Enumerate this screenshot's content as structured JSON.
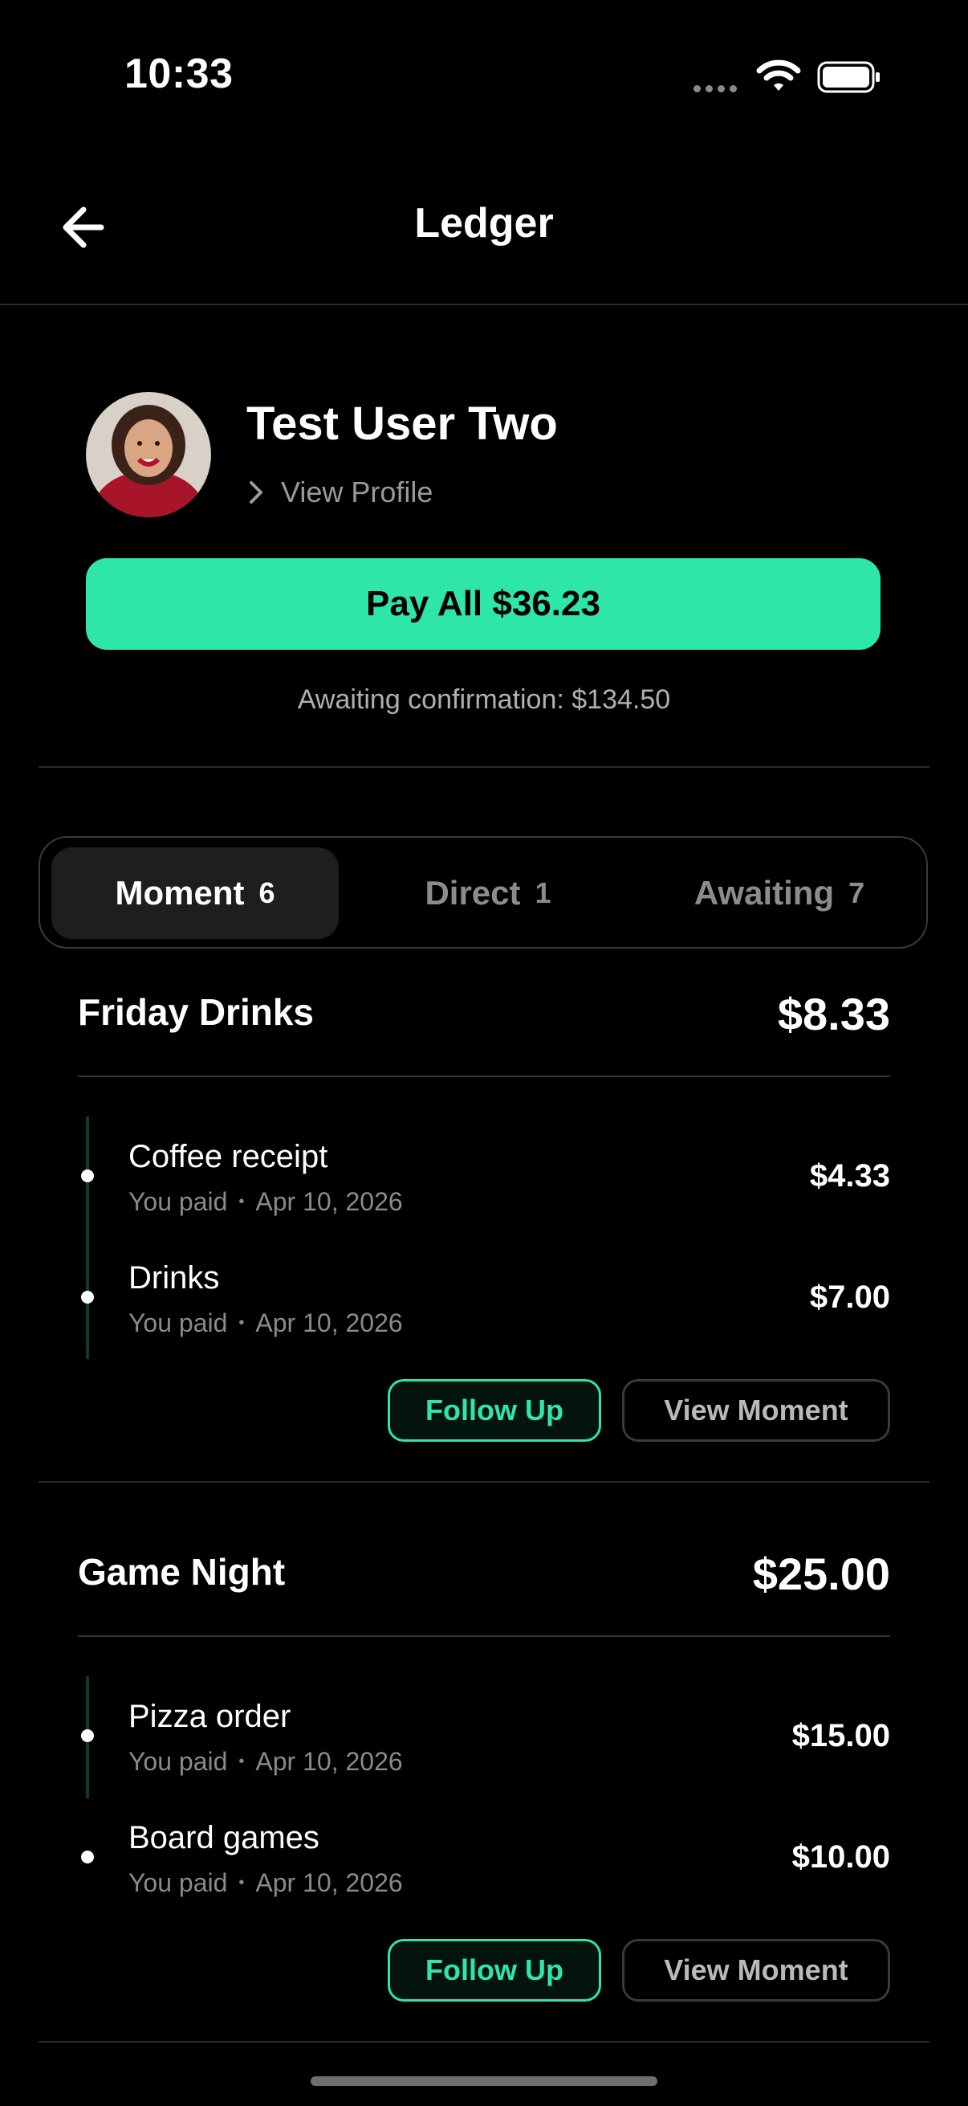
{
  "status_bar": {
    "time": "10:33"
  },
  "header": {
    "title": "Ledger",
    "back_icon": "arrow-left-icon"
  },
  "profile": {
    "name": "Test User Two",
    "view_profile": "View Profile"
  },
  "pay_all": {
    "label": "Pay All $36.23"
  },
  "awaiting_confirmation": "Awaiting confirmation: $134.50",
  "tabs": [
    {
      "label": "Moment",
      "count": "6",
      "active": true
    },
    {
      "label": "Direct",
      "count": "1",
      "active": false
    },
    {
      "label": "Awaiting",
      "count": "7",
      "active": false
    }
  ],
  "groups": [
    {
      "title": "Friday Drinks",
      "total": "$8.33",
      "items": [
        {
          "title": "Coffee receipt",
          "payer": "You paid",
          "date": "Apr 10, 2026",
          "amount": "$4.33"
        },
        {
          "title": "Drinks",
          "payer": "You paid",
          "date": "Apr 10, 2026",
          "amount": "$7.00"
        }
      ],
      "follow_up": "Follow Up",
      "view_moment": "View Moment"
    },
    {
      "title": "Game Night",
      "total": "$25.00",
      "items": [
        {
          "title": "Pizza order",
          "payer": "You paid",
          "date": "Apr 10, 2026",
          "amount": "$15.00"
        },
        {
          "title": "Board games",
          "payer": "You paid",
          "date": "Apr 10, 2026",
          "amount": "$10.00"
        }
      ],
      "follow_up": "Follow Up",
      "view_moment": "View Moment"
    }
  ],
  "colors": {
    "accent": "#2ee6a8",
    "background": "#000000",
    "muted": "#8a8a8a"
  }
}
